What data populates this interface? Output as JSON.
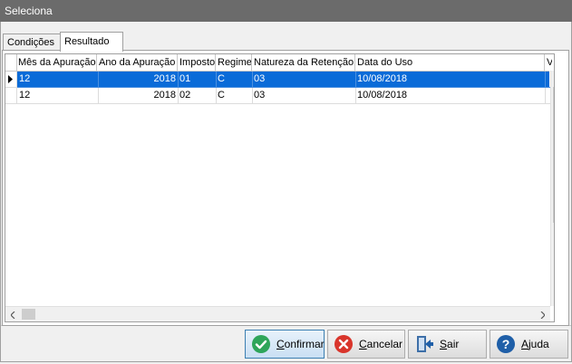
{
  "window": {
    "title": "Seleciona"
  },
  "tabs": [
    {
      "label": "Condições",
      "active": false
    },
    {
      "label": "Resultado",
      "active": true
    }
  ],
  "grid": {
    "columns": [
      "Mês da Apuração",
      "Ano da Apuração",
      "Imposto",
      "Regime",
      "Natureza da Retenção",
      "Data do Uso",
      "V"
    ],
    "rows": [
      {
        "selected": true,
        "cells": [
          "12",
          "2018",
          "01",
          "C",
          "03",
          "10/08/2018",
          ""
        ]
      },
      {
        "selected": false,
        "cells": [
          "12",
          "2018",
          "02",
          "C",
          "03",
          "10/08/2018",
          ""
        ]
      }
    ]
  },
  "buttons": {
    "confirm": {
      "mnemonic": "C",
      "rest": "onfirmar",
      "icon": "check-icon"
    },
    "cancel": {
      "mnemonic": "C",
      "rest": "ancelar",
      "icon": "cancel-x-icon"
    },
    "exit": {
      "mnemonic": "S",
      "rest": "air",
      "icon": "exit-door-icon"
    },
    "help": {
      "mnemonic": "A",
      "rest": "juda",
      "icon": "help-icon"
    }
  },
  "colors": {
    "titlebar": "#6b6b6b",
    "selection": "#0a6bd8",
    "confirm_icon": "#2ea55a",
    "cancel_icon": "#d9352b",
    "help_icon": "#1f5fa8"
  }
}
